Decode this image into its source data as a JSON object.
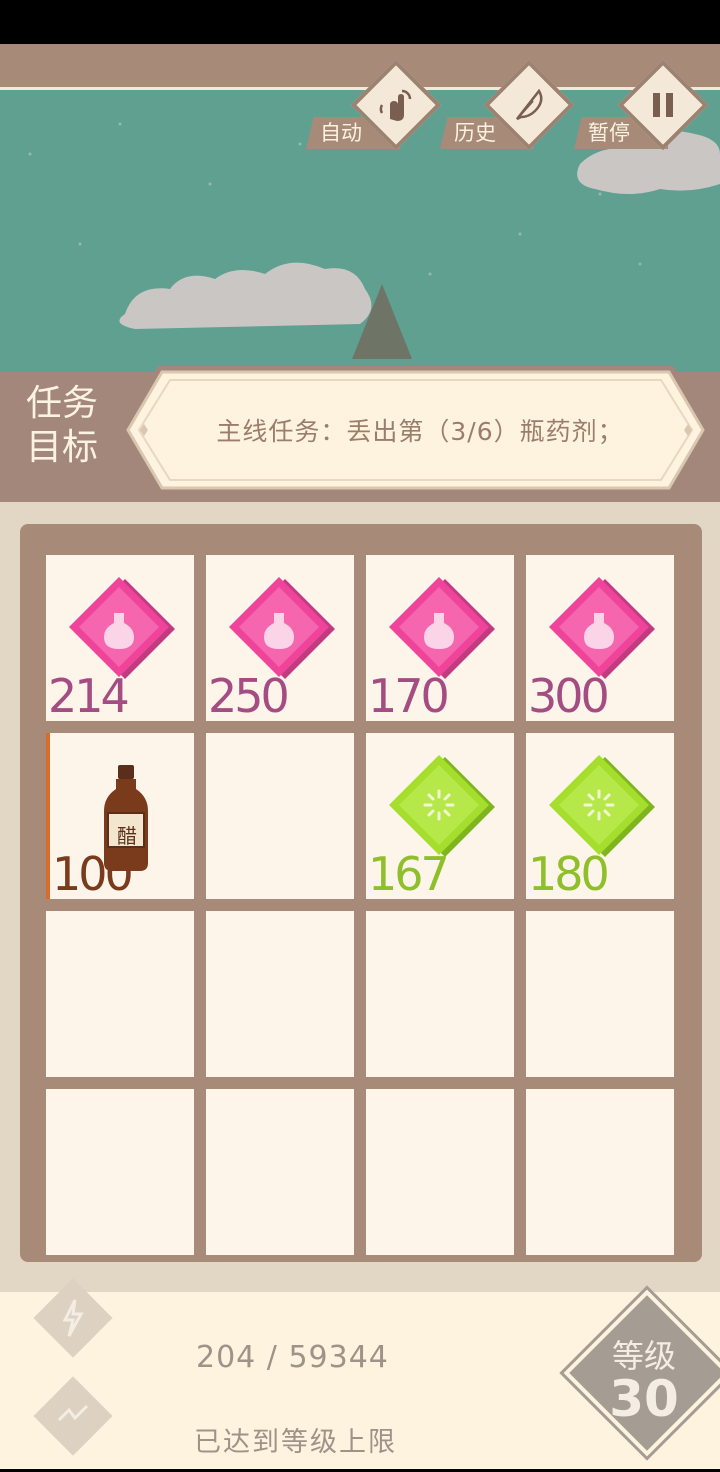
{
  "toolbar": {
    "auto_label": "自动",
    "history_label": "历史",
    "pause_label": "暂停"
  },
  "task": {
    "title_line1": "任务",
    "title_line2": "目标",
    "text": "主线任务：丢出第（3/6）瓶药剂；"
  },
  "board": {
    "cells": [
      {
        "type": "potion-pink",
        "value": "214",
        "color": "#a44d82"
      },
      {
        "type": "potion-pink",
        "value": "250",
        "color": "#a44d82"
      },
      {
        "type": "potion-pink",
        "value": "170",
        "color": "#a44d82"
      },
      {
        "type": "potion-pink",
        "value": "300",
        "color": "#a44d82"
      },
      {
        "type": "vinegar-bottle",
        "value": "100",
        "label": "醋",
        "color": "#7a3a1c"
      },
      {
        "type": "empty"
      },
      {
        "type": "gem-green",
        "value": "167",
        "color": "#8fbf2a"
      },
      {
        "type": "gem-green",
        "value": "180",
        "color": "#8fbf2a"
      },
      {
        "type": "empty"
      },
      {
        "type": "empty"
      },
      {
        "type": "empty"
      },
      {
        "type": "empty"
      },
      {
        "type": "empty"
      },
      {
        "type": "empty"
      },
      {
        "type": "empty"
      },
      {
        "type": "empty"
      }
    ]
  },
  "bottom": {
    "progress": "204 / 59344",
    "status": "已达到等级上限",
    "level_label": "等级",
    "level_value": "30"
  },
  "colors": {
    "sky": "#5fa091",
    "frame": "#a78a77",
    "pink_gem": "#f0449b",
    "green_gem": "#a6de2e"
  }
}
